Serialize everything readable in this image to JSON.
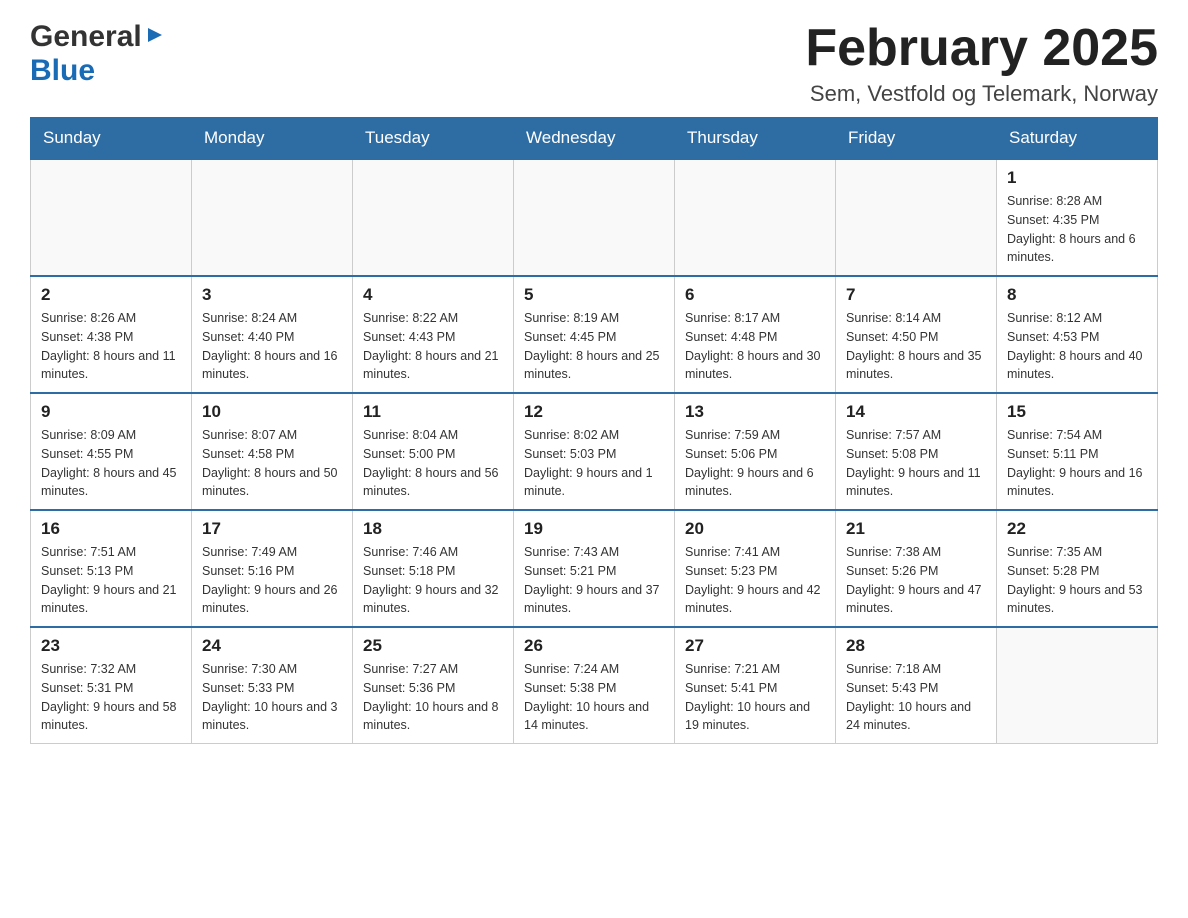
{
  "header": {
    "logo_general": "General",
    "logo_blue": "Blue",
    "title": "February 2025",
    "subtitle": "Sem, Vestfold og Telemark, Norway"
  },
  "days_of_week": [
    "Sunday",
    "Monday",
    "Tuesday",
    "Wednesday",
    "Thursday",
    "Friday",
    "Saturday"
  ],
  "weeks": [
    {
      "days": [
        {
          "number": "",
          "info": ""
        },
        {
          "number": "",
          "info": ""
        },
        {
          "number": "",
          "info": ""
        },
        {
          "number": "",
          "info": ""
        },
        {
          "number": "",
          "info": ""
        },
        {
          "number": "",
          "info": ""
        },
        {
          "number": "1",
          "info": "Sunrise: 8:28 AM\nSunset: 4:35 PM\nDaylight: 8 hours and 6 minutes."
        }
      ]
    },
    {
      "days": [
        {
          "number": "2",
          "info": "Sunrise: 8:26 AM\nSunset: 4:38 PM\nDaylight: 8 hours and 11 minutes."
        },
        {
          "number": "3",
          "info": "Sunrise: 8:24 AM\nSunset: 4:40 PM\nDaylight: 8 hours and 16 minutes."
        },
        {
          "number": "4",
          "info": "Sunrise: 8:22 AM\nSunset: 4:43 PM\nDaylight: 8 hours and 21 minutes."
        },
        {
          "number": "5",
          "info": "Sunrise: 8:19 AM\nSunset: 4:45 PM\nDaylight: 8 hours and 25 minutes."
        },
        {
          "number": "6",
          "info": "Sunrise: 8:17 AM\nSunset: 4:48 PM\nDaylight: 8 hours and 30 minutes."
        },
        {
          "number": "7",
          "info": "Sunrise: 8:14 AM\nSunset: 4:50 PM\nDaylight: 8 hours and 35 minutes."
        },
        {
          "number": "8",
          "info": "Sunrise: 8:12 AM\nSunset: 4:53 PM\nDaylight: 8 hours and 40 minutes."
        }
      ]
    },
    {
      "days": [
        {
          "number": "9",
          "info": "Sunrise: 8:09 AM\nSunset: 4:55 PM\nDaylight: 8 hours and 45 minutes."
        },
        {
          "number": "10",
          "info": "Sunrise: 8:07 AM\nSunset: 4:58 PM\nDaylight: 8 hours and 50 minutes."
        },
        {
          "number": "11",
          "info": "Sunrise: 8:04 AM\nSunset: 5:00 PM\nDaylight: 8 hours and 56 minutes."
        },
        {
          "number": "12",
          "info": "Sunrise: 8:02 AM\nSunset: 5:03 PM\nDaylight: 9 hours and 1 minute."
        },
        {
          "number": "13",
          "info": "Sunrise: 7:59 AM\nSunset: 5:06 PM\nDaylight: 9 hours and 6 minutes."
        },
        {
          "number": "14",
          "info": "Sunrise: 7:57 AM\nSunset: 5:08 PM\nDaylight: 9 hours and 11 minutes."
        },
        {
          "number": "15",
          "info": "Sunrise: 7:54 AM\nSunset: 5:11 PM\nDaylight: 9 hours and 16 minutes."
        }
      ]
    },
    {
      "days": [
        {
          "number": "16",
          "info": "Sunrise: 7:51 AM\nSunset: 5:13 PM\nDaylight: 9 hours and 21 minutes."
        },
        {
          "number": "17",
          "info": "Sunrise: 7:49 AM\nSunset: 5:16 PM\nDaylight: 9 hours and 26 minutes."
        },
        {
          "number": "18",
          "info": "Sunrise: 7:46 AM\nSunset: 5:18 PM\nDaylight: 9 hours and 32 minutes."
        },
        {
          "number": "19",
          "info": "Sunrise: 7:43 AM\nSunset: 5:21 PM\nDaylight: 9 hours and 37 minutes."
        },
        {
          "number": "20",
          "info": "Sunrise: 7:41 AM\nSunset: 5:23 PM\nDaylight: 9 hours and 42 minutes."
        },
        {
          "number": "21",
          "info": "Sunrise: 7:38 AM\nSunset: 5:26 PM\nDaylight: 9 hours and 47 minutes."
        },
        {
          "number": "22",
          "info": "Sunrise: 7:35 AM\nSunset: 5:28 PM\nDaylight: 9 hours and 53 minutes."
        }
      ]
    },
    {
      "days": [
        {
          "number": "23",
          "info": "Sunrise: 7:32 AM\nSunset: 5:31 PM\nDaylight: 9 hours and 58 minutes."
        },
        {
          "number": "24",
          "info": "Sunrise: 7:30 AM\nSunset: 5:33 PM\nDaylight: 10 hours and 3 minutes."
        },
        {
          "number": "25",
          "info": "Sunrise: 7:27 AM\nSunset: 5:36 PM\nDaylight: 10 hours and 8 minutes."
        },
        {
          "number": "26",
          "info": "Sunrise: 7:24 AM\nSunset: 5:38 PM\nDaylight: 10 hours and 14 minutes."
        },
        {
          "number": "27",
          "info": "Sunrise: 7:21 AM\nSunset: 5:41 PM\nDaylight: 10 hours and 19 minutes."
        },
        {
          "number": "28",
          "info": "Sunrise: 7:18 AM\nSunset: 5:43 PM\nDaylight: 10 hours and 24 minutes."
        },
        {
          "number": "",
          "info": ""
        }
      ]
    }
  ]
}
